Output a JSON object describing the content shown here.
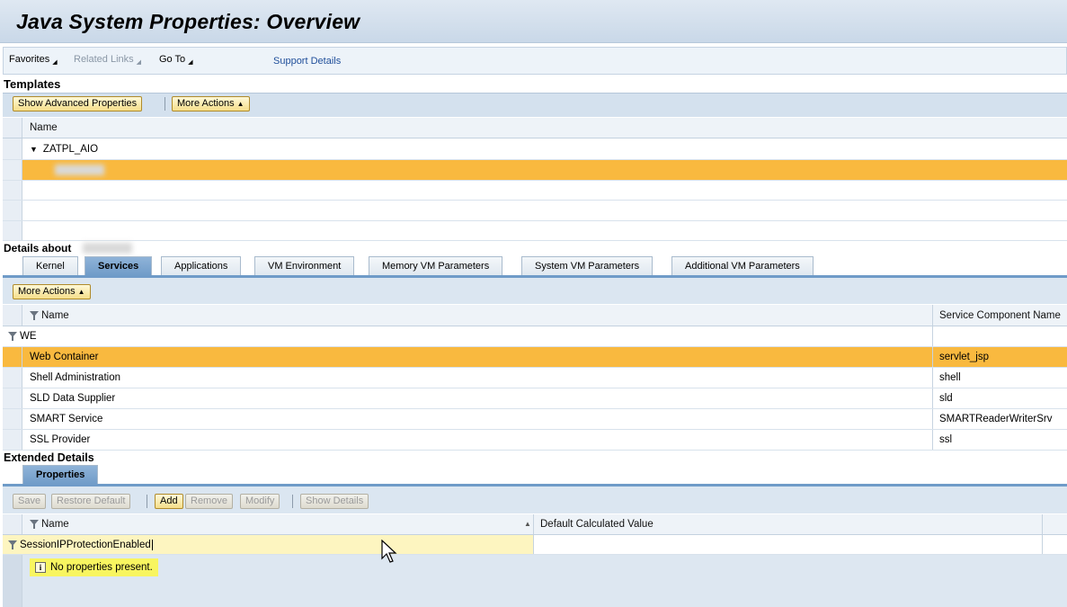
{
  "page": {
    "title": "Java System Properties: Overview"
  },
  "menu": {
    "favorites": "Favorites",
    "related_links": "Related Links",
    "go_to": "Go To",
    "support_details": "Support Details"
  },
  "templates": {
    "section_title": "Templates",
    "buttons": {
      "show_advanced": "Show Advanced Properties",
      "more_actions": "More Actions"
    },
    "column_name": "Name",
    "rows": [
      "ZATPL_AIO"
    ]
  },
  "details": {
    "section_title": "Details about",
    "tabs": [
      "Kernel",
      "Services",
      "Applications",
      "VM Environment",
      "Memory VM Parameters",
      "System VM Parameters",
      "Additional VM Parameters"
    ],
    "active_tab": "Services",
    "more_actions": "More Actions",
    "columns": {
      "name": "Name",
      "component": "Service Component Name"
    },
    "filter_value": "WE",
    "rows": [
      {
        "name": "Web Container",
        "component": "servlet_jsp"
      },
      {
        "name": "Shell Administration",
        "component": "shell"
      },
      {
        "name": "SLD Data Supplier",
        "component": "sld"
      },
      {
        "name": "SMART Service",
        "component": "SMARTReaderWriterSrv"
      },
      {
        "name": "SSL Provider",
        "component": "ssl"
      }
    ]
  },
  "extended": {
    "section_title": "Extended Details",
    "tab": "Properties",
    "buttons": {
      "save": "Save",
      "restore": "Restore Default",
      "add": "Add",
      "remove": "Remove",
      "modify": "Modify",
      "show_details": "Show Details"
    },
    "columns": {
      "name": "Name",
      "default_value": "Default Calculated Value"
    },
    "filter_value": "SessionIPProtectionEnabled",
    "message": "No properties present."
  }
}
